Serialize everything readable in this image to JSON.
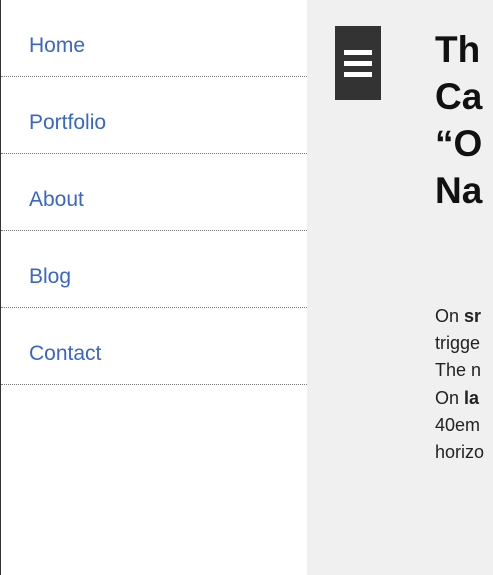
{
  "sidebar": {
    "items": [
      {
        "label": "Home"
      },
      {
        "label": "Portfolio"
      },
      {
        "label": "About"
      },
      {
        "label": "Blog"
      },
      {
        "label": "Contact"
      }
    ]
  },
  "main": {
    "menu_button_icon": "hamburger-icon",
    "title_lines": [
      "Th",
      "Ca",
      "“O",
      "Na"
    ],
    "paragraphs": [
      {
        "lead": "On ",
        "bold": "sr",
        "lines": [
          "trigge",
          "The n"
        ]
      },
      {
        "lead": "On ",
        "bold": "la",
        "lines": [
          "40em",
          "horizo"
        ]
      }
    ]
  },
  "colors": {
    "link": "#3a66c4",
    "main_background": "#f0f0f0",
    "menu_button": "#333333"
  }
}
